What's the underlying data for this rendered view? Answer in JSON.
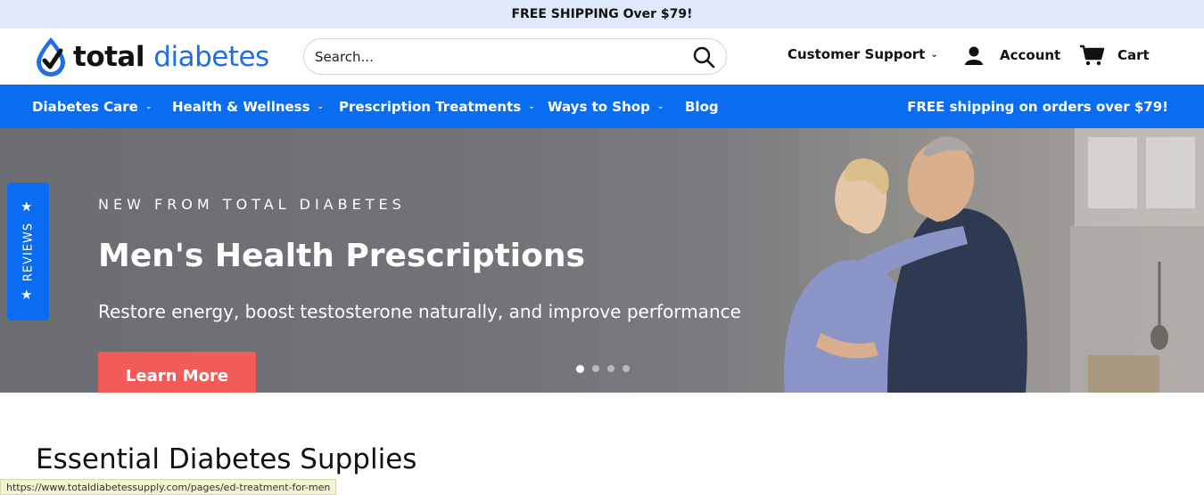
{
  "announcement": "FREE SHIPPING Over $79!",
  "brand": {
    "name_part1": "total",
    "name_part2": "diabetes"
  },
  "search": {
    "placeholder": "Search..."
  },
  "header": {
    "support_label": "Customer Support",
    "account_label": "Account",
    "cart_label": "Cart"
  },
  "nav": {
    "items": [
      {
        "label": "Diabetes Care"
      },
      {
        "label": "Health & Wellness"
      },
      {
        "label": "Prescription Treatments"
      },
      {
        "label": "Ways to Shop"
      },
      {
        "label": "Blog"
      }
    ],
    "promo": "FREE shipping on orders over $79!"
  },
  "hero": {
    "eyebrow": "NEW FROM TOTAL DIABETES",
    "title": "Men's Health Prescriptions",
    "subtitle": "Restore energy, boost testosterone naturally, and improve performance",
    "cta": "Learn More",
    "slide_count": 4,
    "active_slide": 1
  },
  "reviews_tab": "REVIEWS",
  "section_title": "Essential Diabetes Supplies",
  "status_url": "https://www.totaldiabetessupply.com/pages/ed-treatment-for-men",
  "colors": {
    "brand_blue": "#0a6cf0",
    "cta_red": "#f25b58",
    "announce_bg": "#dfe9fb"
  }
}
